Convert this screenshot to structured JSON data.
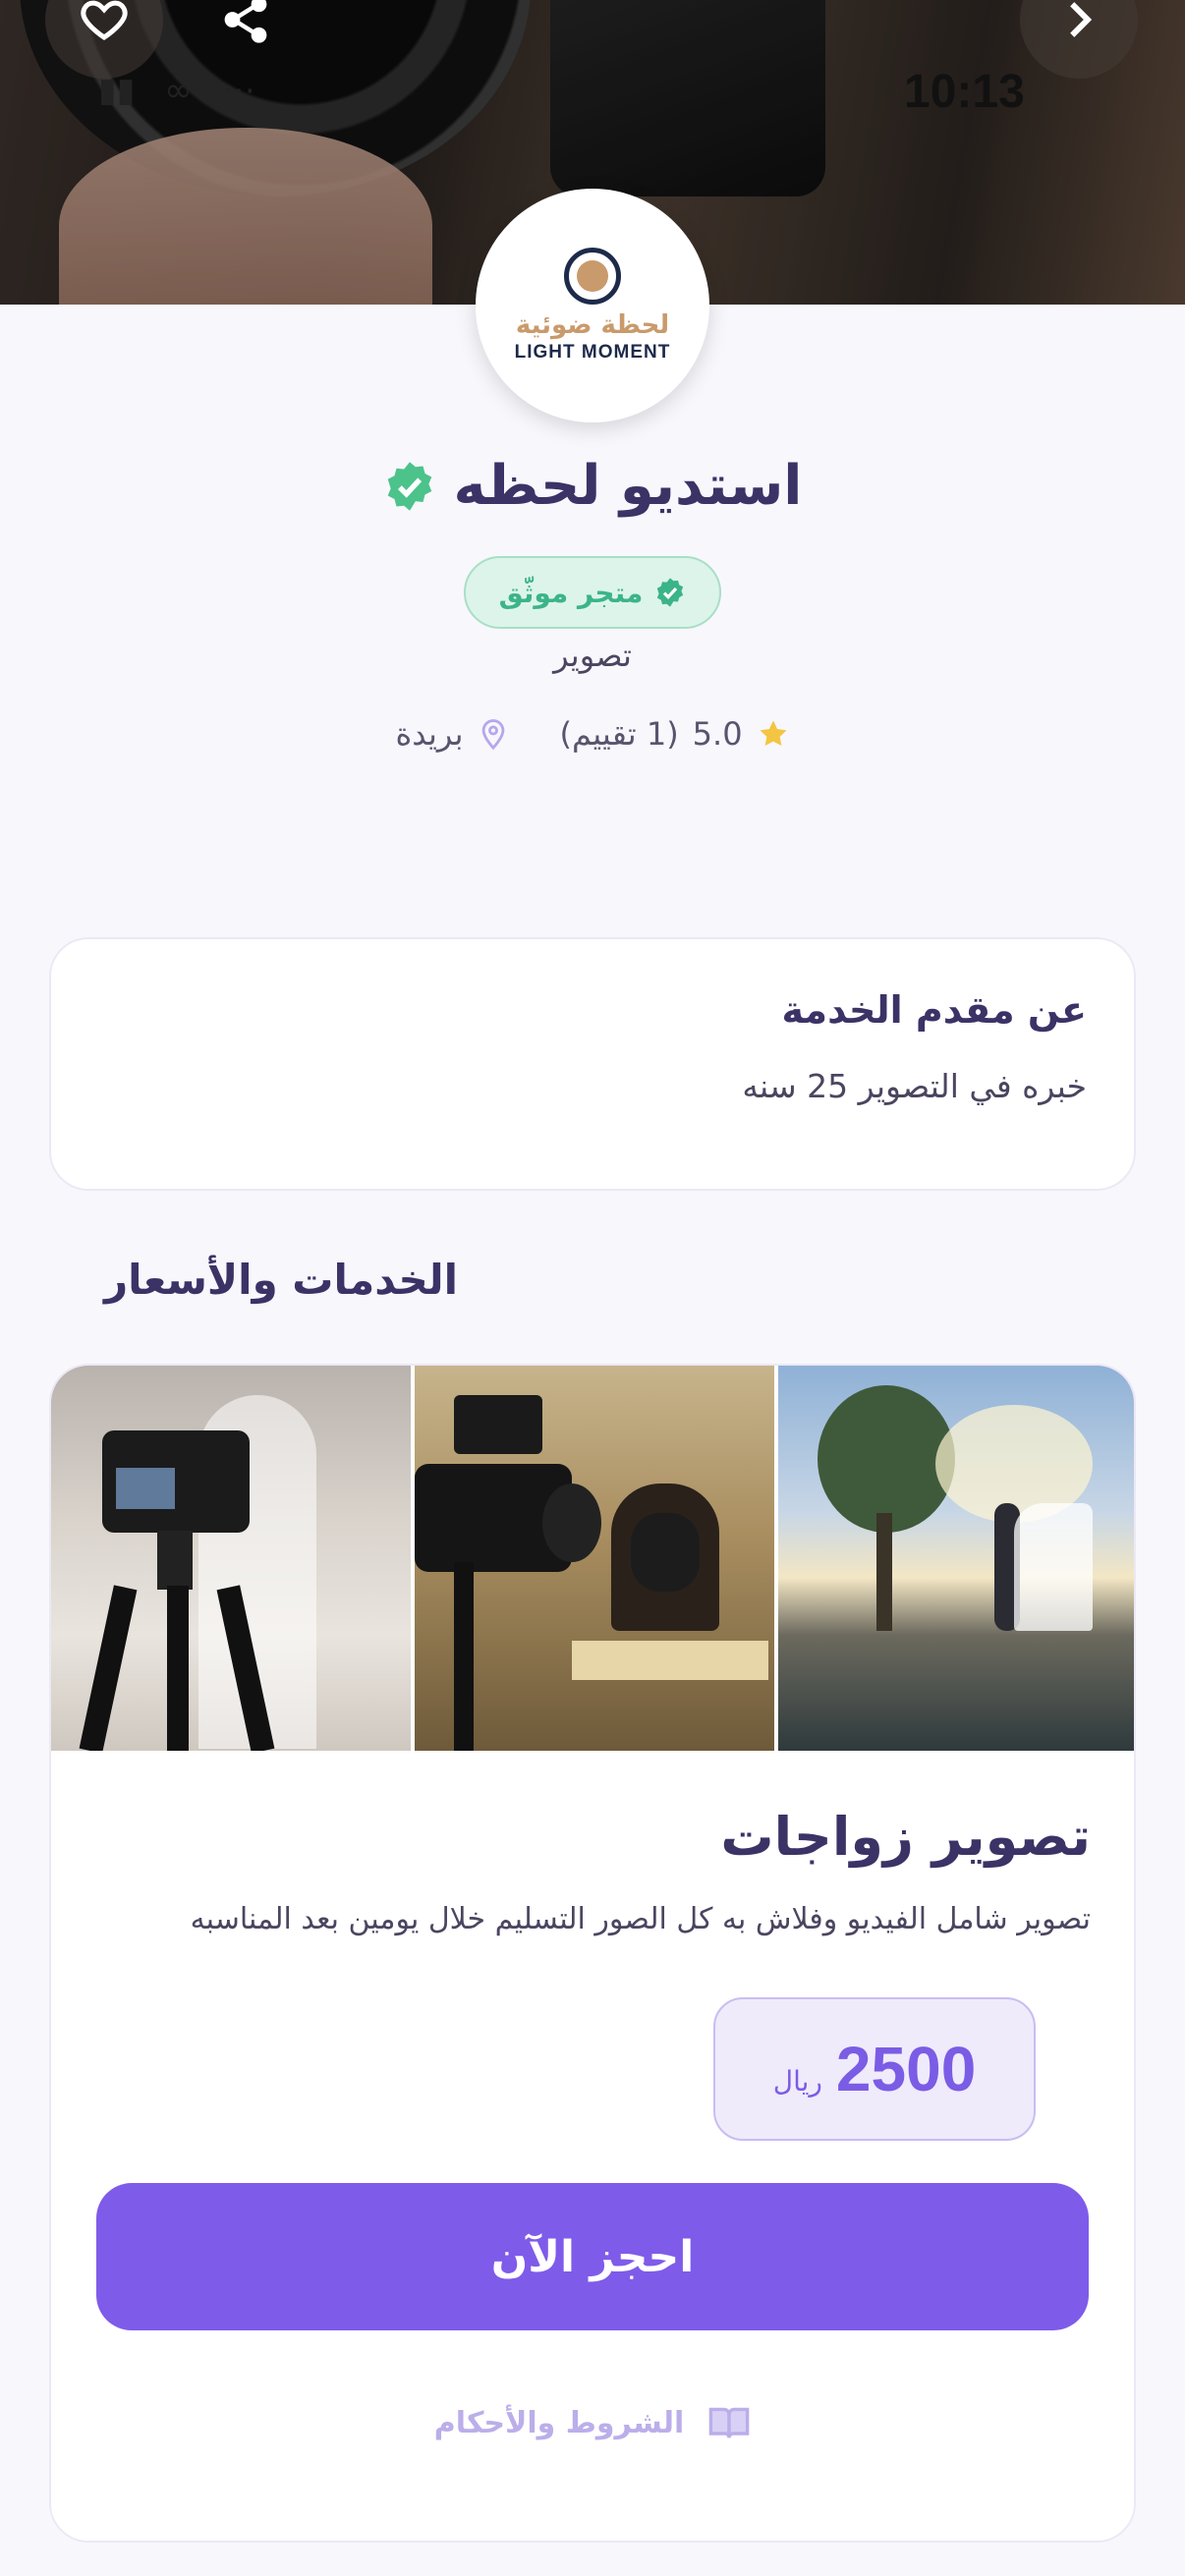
{
  "status_bar": {
    "time": "10:13"
  },
  "header": {
    "logo": {
      "text_ar": "لحظة ضوئية",
      "text_en": "LIGHT MOMENT"
    },
    "icons": [
      "heart-icon",
      "share-icon",
      "chevron-right-icon"
    ]
  },
  "profile": {
    "name": "استديو لحظه",
    "verified_label": "متجر موثّق",
    "category": "تصوير",
    "rating": "5.0",
    "reviews": "(1 تقييم)",
    "city": "بريدة"
  },
  "about": {
    "title": "عن مقدم الخدمة",
    "text": "خبره في التصوير 25 سنه"
  },
  "services_section": {
    "title": "الخدمات والأسعار"
  },
  "service": {
    "title": "تصوير زواجات",
    "description": "تصوير شامل الفيديو وفلاش به كل الصور التسليم خلال يومين بعد المناسبه",
    "price": "2500",
    "currency": "ريال",
    "book_label": "احجز الآن",
    "terms_label": "الشروط والأحكام"
  },
  "colors": {
    "primary": "#7F5BEA",
    "title": "#3b3366",
    "verified_green": "#3BB489",
    "star": "#F4C542",
    "background": "#F8F7FC"
  }
}
